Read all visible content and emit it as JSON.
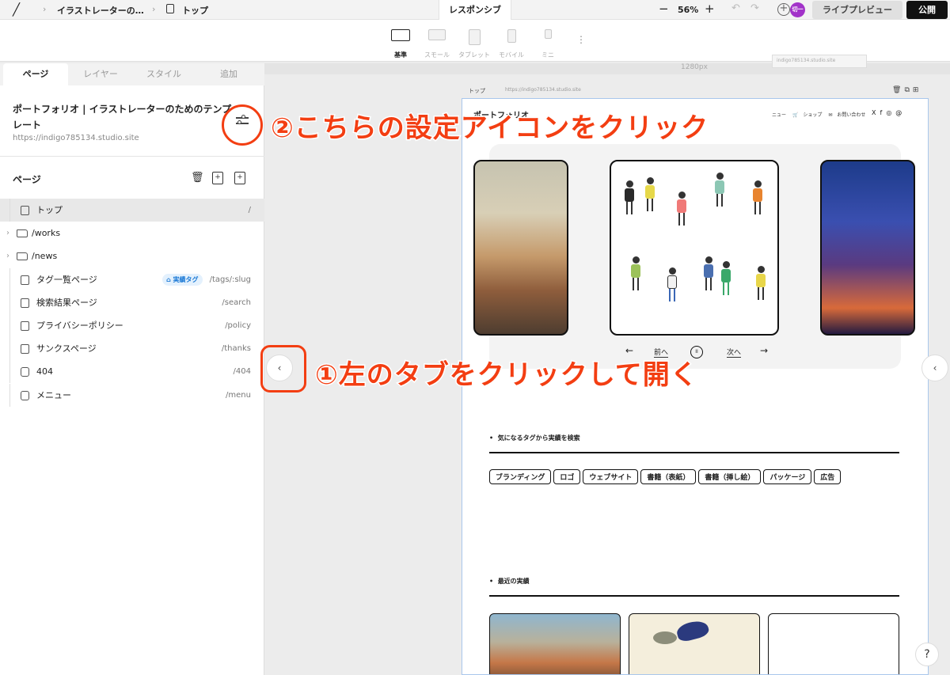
{
  "topbar": {
    "breadcrumb": [
      "イラストレーターの…",
      "トップ"
    ],
    "mode_tab": "レスポンシブ",
    "zoom": "56%",
    "user_initials": "切一",
    "live_preview": "ライブプレビュー",
    "publish": "公開"
  },
  "devices": [
    "基準",
    "スモール",
    "タブレット",
    "モバイル",
    "ミニ"
  ],
  "panel": {
    "tabs": [
      "ページ",
      "レイヤー",
      "スタイル",
      "追加"
    ],
    "site_title": "ポートフォリオ | イラストレーターのためのテンプレート",
    "site_url": "https://indigo785134.studio.site",
    "pages_heading": "ページ",
    "pages": [
      {
        "name": "トップ",
        "path": "/"
      },
      {
        "name": "/works",
        "path": ""
      },
      {
        "name": "/news",
        "path": ""
      },
      {
        "name": "タグ一覧ページ",
        "path": "/tags/:slug",
        "badge": "実績タグ"
      },
      {
        "name": "検索結果ページ",
        "path": "/search"
      },
      {
        "name": "プライバシーポリシー",
        "path": "/policy"
      },
      {
        "name": "サンクスページ",
        "path": "/thanks"
      },
      {
        "name": "404",
        "path": "/404"
      },
      {
        "name": "メニュー",
        "path": "/menu"
      }
    ]
  },
  "canvas": {
    "width_label": "1280px",
    "ghost_url": "indigo785134.studio.site",
    "frame_label": "トップ",
    "frame_url": "https://indigo785134.studio.site",
    "site": {
      "title": "ポートフォリオ",
      "nav": [
        "ニュー",
        "ショップ",
        "お問い合わせ"
      ],
      "carousel_prev": "前へ",
      "carousel_next": "次へ",
      "section1": "気になるタグから実績を検索",
      "tags": [
        "ブランディング",
        "ロゴ",
        "ウェブサイト",
        "書籍（表紙）",
        "書籍（挿し絵）",
        "パッケージ",
        "広告"
      ],
      "section2": "最近の実績"
    }
  },
  "annotations": {
    "step1": "①左のタブをクリックして開く",
    "step2": "②こちらの設定アイコンをクリック"
  },
  "colors": {
    "annotation": "#f33e12",
    "badge": "#1d7ad6",
    "frame_border": "#a9c7ec"
  }
}
